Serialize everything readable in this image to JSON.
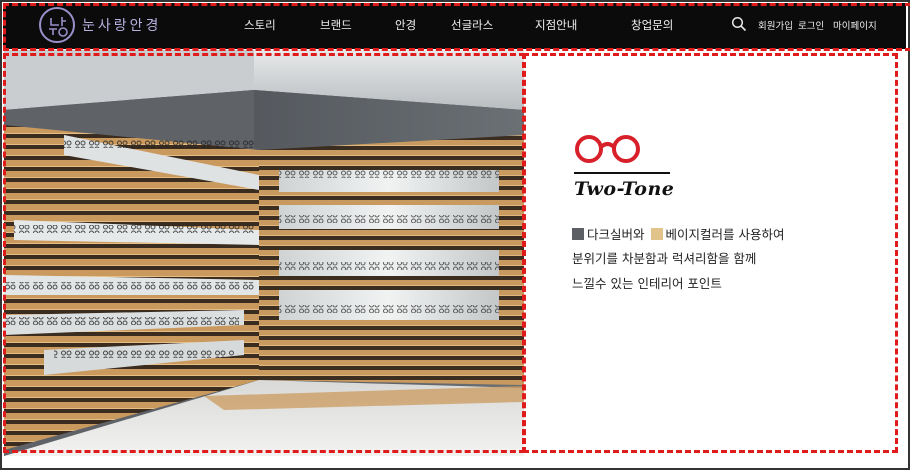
{
  "brand": {
    "name": "눈사랑안경"
  },
  "nav": {
    "items": [
      {
        "label": "스토리"
      },
      {
        "label": "브랜드"
      },
      {
        "label": "안경"
      },
      {
        "label": "선글라스"
      },
      {
        "label": "지점안내"
      },
      {
        "label": "창업문의"
      }
    ]
  },
  "util": {
    "signup": "회원가입",
    "login": "로그인",
    "mypage": "마이페이지"
  },
  "feature": {
    "title": "Two-Tone",
    "line1_a": "다크실버와",
    "line1_b": "베이지컬러를 사용하여",
    "line2": "분위기를 차분함과 럭셔리함을 함께",
    "line3": "느낄수 있는 인테리어 포인트"
  },
  "colors": {
    "accent_red": "#d8202a",
    "dark_silver": "#5c5f63",
    "beige": "#e2c48a",
    "header_bg": "#0b0b0b"
  }
}
